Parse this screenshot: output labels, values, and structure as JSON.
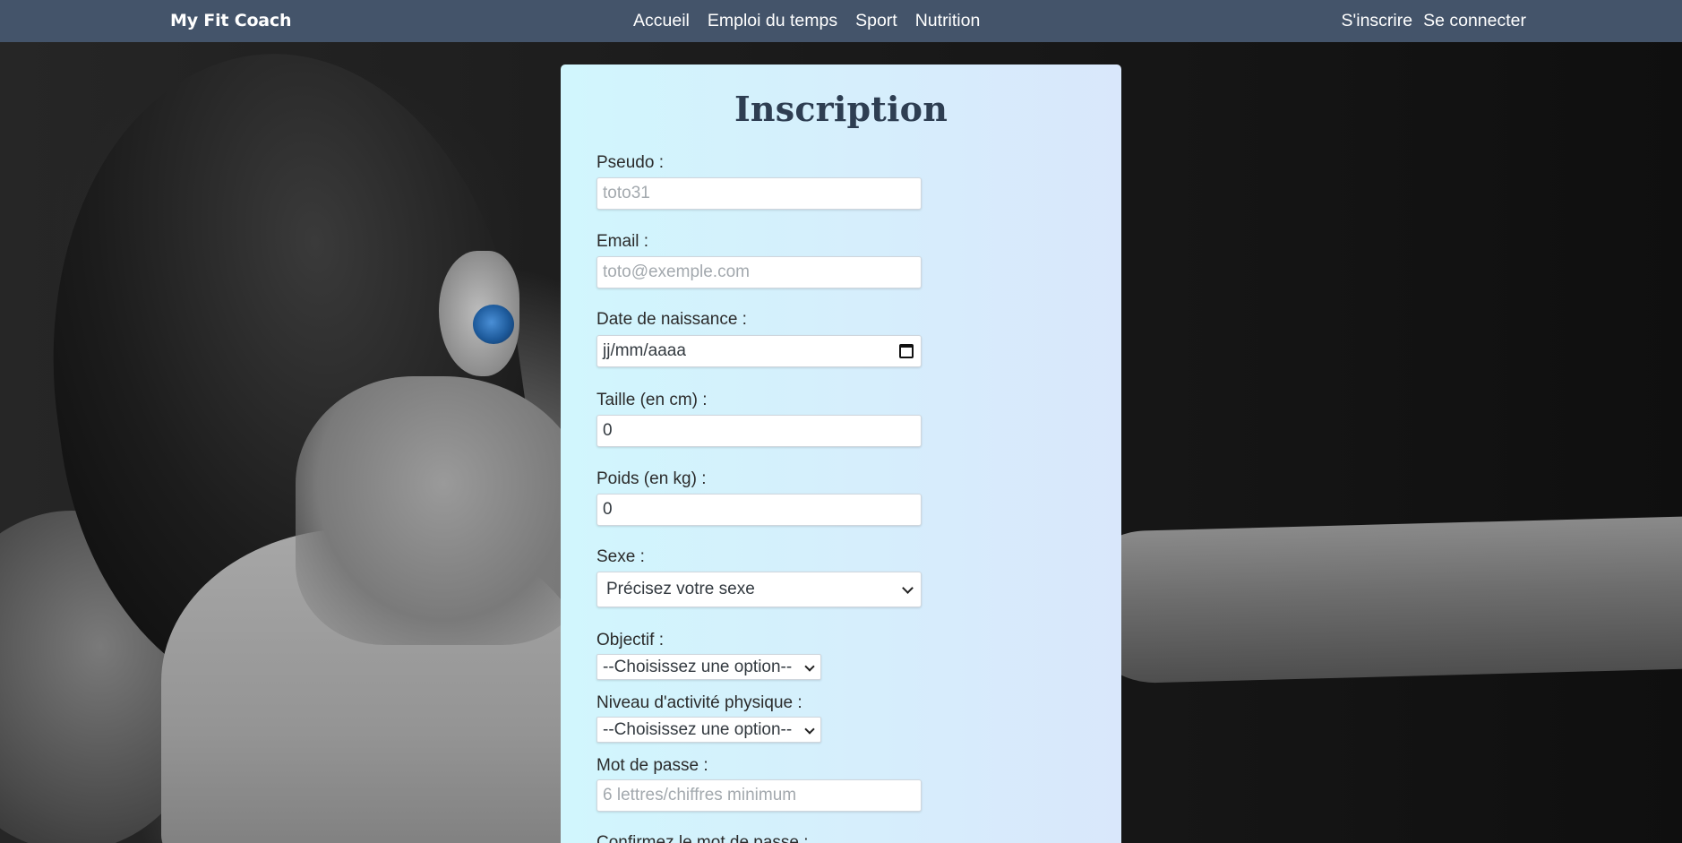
{
  "navbar": {
    "brand": "My Fit Coach",
    "links": [
      "Accueil",
      "Emploi du temps",
      "Sport",
      "Nutrition"
    ],
    "auth": {
      "signup": "S'inscrire",
      "login": "Se connecter"
    }
  },
  "form": {
    "title": "Inscription",
    "pseudo": {
      "label": "Pseudo :",
      "placeholder": "toto31"
    },
    "email": {
      "label": "Email :",
      "placeholder": "toto@exemple.com"
    },
    "birthdate": {
      "label": "Date de naissance :",
      "value": "jj/mm/aaaa"
    },
    "height": {
      "label": "Taille (en cm) :",
      "value": "0"
    },
    "weight": {
      "label": "Poids (en kg) :",
      "value": "0"
    },
    "sex": {
      "label": "Sexe :",
      "selected": "Précisez votre sexe"
    },
    "goal": {
      "label": "Objectif :",
      "selected": "--Choisissez une option--"
    },
    "activity": {
      "label": "Niveau d'activité physique :",
      "selected": "--Choisissez une option--"
    },
    "password": {
      "label": "Mot de passe :",
      "placeholder": "6 lettres/chiffres minimum"
    },
    "confirm_password": {
      "label": "Confirmez le mot de passe :"
    }
  },
  "colors": {
    "navbar_bg": "#44546a",
    "card_bg_start": "#d1f6fd",
    "card_bg_end": "#d9e7fb",
    "title": "#2e3e52"
  },
  "icons": {
    "date_picker": "calendar-icon",
    "select_arrow": "chevron-down-icon"
  }
}
